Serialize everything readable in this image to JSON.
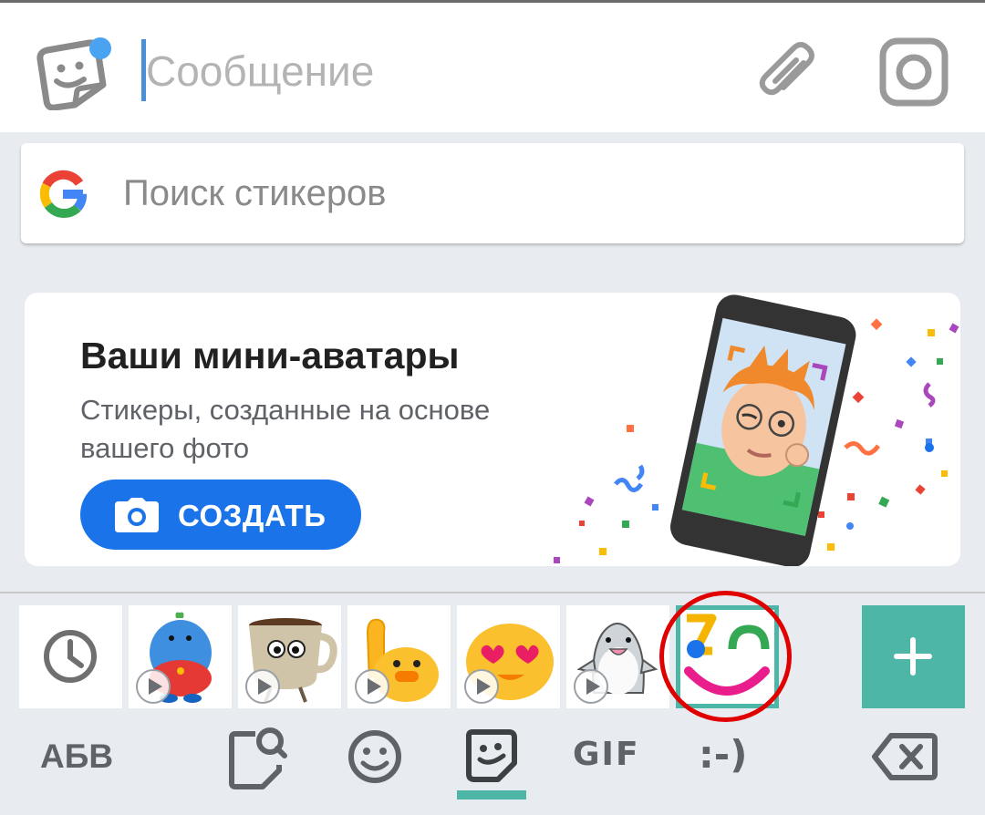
{
  "compose": {
    "placeholder": "Сообщение",
    "sticker_icon": "sticker-smile-icon",
    "attach_icon": "paperclip-icon",
    "camera_icon": "instagram-camera-icon",
    "accent_color": "#4a90d9"
  },
  "sticker_search": {
    "logo": "google-g-icon",
    "placeholder": "Поиск стикеров"
  },
  "promo": {
    "title": "Ваши мини-аватары",
    "subtitle": "Стикеры, созданные на основе вашего фото",
    "button_label": "СОЗДАТЬ",
    "button_icon": "camera-icon",
    "button_color": "#1a73e8"
  },
  "sticker_tray": {
    "items": [
      {
        "name": "recent",
        "icon": "clock-icon"
      },
      {
        "name": "blue-creature",
        "animated": true
      },
      {
        "name": "coffee-cup",
        "animated": true
      },
      {
        "name": "blob-flex",
        "animated": true
      },
      {
        "name": "blob-heart-eyes",
        "animated": true
      },
      {
        "name": "shark",
        "animated": true
      },
      {
        "name": "mini-avatars",
        "selected": true
      }
    ],
    "add_icon": "plus-icon",
    "add_color": "#4db6a6",
    "highlight_color": "#e00000"
  },
  "bottom_bar": {
    "abc_label": "АБВ",
    "gif_label": "GIF",
    "emoticon_label": ":-)",
    "active_tab": "stickers",
    "active_color": "#4db6a6"
  }
}
